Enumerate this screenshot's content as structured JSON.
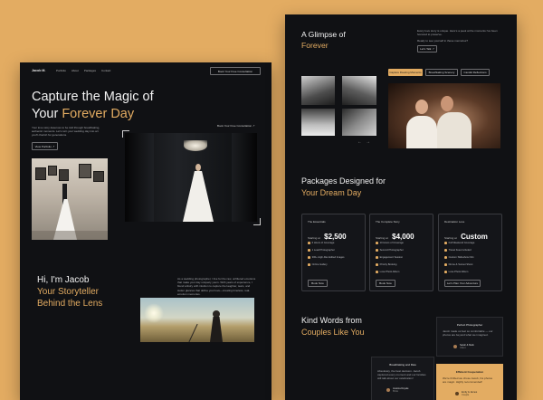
{
  "left": {
    "nav": {
      "logo": "Jacob M.",
      "links": [
        "Portfolio",
        "About",
        "Packages",
        "Contact"
      ],
      "cta": "Book Your Free Consultation"
    },
    "hero": {
      "title_line1": "Capture the Magic of",
      "title_line2_plain": "Your ",
      "title_line2_accent": "Forever Day",
      "desc": "Your love story deserves to be told through breathtaking, authentic moments. Let's turn your wedding day into art you'll cherish for generations.",
      "view_button": "View Portfolio",
      "book_link": "Book Your Free Consultation"
    },
    "about": {
      "line1": "Hi, I'm Jacob",
      "line2": "Your Storyteller",
      "line3": "Behind the Lens",
      "desc": "As a wedding photographer, I live for the raw, unfiltered emotions that make your day uniquely yours. With years of experience, I blend artistry with intuition to capture the laughter, tears, and stolen glances that define your love—creating timeless, real-emotion memories."
    }
  },
  "right": {
    "glimpse": {
      "title_line1": "A Glimpse of",
      "title_line2": "Forever",
      "desc": "Every love story is unique. Here's a peek at the moments I've been honored to preserve.",
      "question": "Ready to see yourself in these memories?",
      "link": "Let's Talk",
      "filters": [
        "Capture Fleeting Moments",
        "Breathtaking Scenery",
        "Candid Reflections"
      ]
    },
    "packages": {
      "title_line1": "Packages Designed for",
      "title_line2": "Your Dream Day",
      "cards": [
        {
          "name": "The Essentials",
          "starting": "Starting at",
          "price": "$2,500",
          "features": [
            "6 Hours of Coverage",
            "1 Lead Photographer",
            "300+ High-Res Edited Images",
            "Online Gallery"
          ],
          "button": "Book Now"
        },
        {
          "name": "The Complete Story",
          "starting": "Starting at",
          "price": "$4,000",
          "features": [
            "10 Hours of Coverage",
            "Second Photographer",
            "Engagement Session",
            "Priority Booking",
            "Luxe Photo Album"
          ],
          "button": "Book Now"
        },
        {
          "name": "Destination Love",
          "starting": "Starting at",
          "price": "Custom",
          "features": [
            "Full Weekend Coverage",
            "Travel Fees Included",
            "Custom Slideshow Film",
            "Drone & Sunset Shoot",
            "Luxe Photo Album"
          ],
          "button": "Let's Plan Your Adventure"
        }
      ]
    },
    "testimonials": {
      "title_line1": "Kind Words from",
      "title_line2": "Couples Like You",
      "items": [
        {
          "title": "Perfect Photographer",
          "text": "Jacob made us feel so comfortable — our photos are beyond what we imagined.",
          "author": "Sarah & Mark",
          "role": "Client"
        },
        {
          "title": "Breathtaking and Raw",
          "text": "Absolutely, the best decision. Jacob captured every moment and our families still talk about our celebration!",
          "author": "Jessica Doyale",
          "role": "Bride"
        },
        {
          "title": "Efficient Cooperation",
          "text": "We're thrilled we chose Jacob, his photos are magic. Highly recommended!",
          "author": "Emily & James",
          "role": "Couple"
        }
      ]
    }
  },
  "colors": {
    "background": "#e3ac62",
    "panel": "#101114",
    "accent": "#e3ac62"
  },
  "icons": [
    "arrow-up-right-icon",
    "arrow-left-icon",
    "arrow-right-icon",
    "star-icon"
  ]
}
